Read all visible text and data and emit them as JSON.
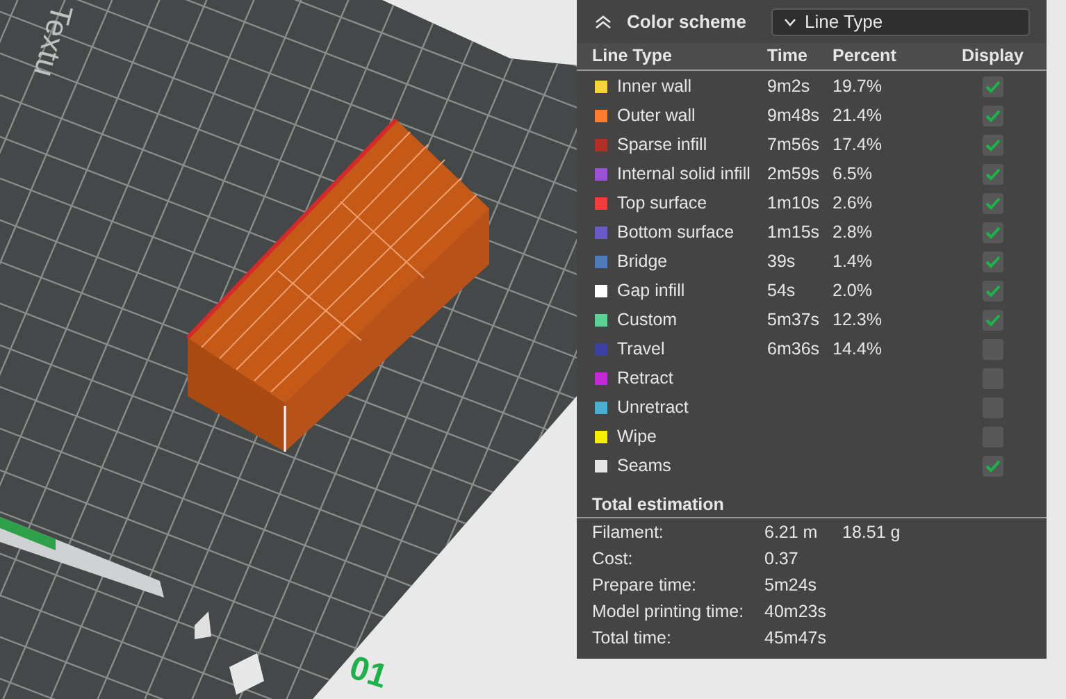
{
  "viewport": {
    "plate_label": "Textu",
    "plate_number": "01"
  },
  "header": {
    "title": "Color scheme",
    "dropdown": {
      "value": "Line Type"
    }
  },
  "table": {
    "columns": [
      "Line Type",
      "Time",
      "Percent",
      "Display"
    ],
    "rows": [
      {
        "name": "Inner wall",
        "color": "#f5d33a",
        "time": "9m2s",
        "percent": "19.7%",
        "display": true
      },
      {
        "name": "Outer wall",
        "color": "#ff7b2e",
        "time": "9m48s",
        "percent": "21.4%",
        "display": true
      },
      {
        "name": "Sparse infill",
        "color": "#b03029",
        "time": "7m56s",
        "percent": "17.4%",
        "display": true
      },
      {
        "name": "Internal solid infill",
        "color": "#9b51d6",
        "time": "2m59s",
        "percent": "6.5%",
        "display": true
      },
      {
        "name": "Top surface",
        "color": "#f03c3c",
        "time": "1m10s",
        "percent": "2.6%",
        "display": true
      },
      {
        "name": "Bottom surface",
        "color": "#6a5bc8",
        "time": "1m15s",
        "percent": "2.8%",
        "display": true
      },
      {
        "name": "Bridge",
        "color": "#4f7cb8",
        "time": "39s",
        "percent": "1.4%",
        "display": true
      },
      {
        "name": "Gap infill",
        "color": "#ffffff",
        "time": "54s",
        "percent": "2.0%",
        "display": true
      },
      {
        "name": "Custom",
        "color": "#5ed196",
        "time": "5m37s",
        "percent": "12.3%",
        "display": true
      },
      {
        "name": "Travel",
        "color": "#3a3fa0",
        "time": "6m36s",
        "percent": "14.4%",
        "display": false
      },
      {
        "name": "Retract",
        "color": "#c42bd6",
        "display": false
      },
      {
        "name": "Unretract",
        "color": "#4aaed0",
        "display": false
      },
      {
        "name": "Wipe",
        "color": "#f5f000",
        "display": false
      },
      {
        "name": "Seams",
        "color": "#e6e6e6",
        "display": true
      }
    ]
  },
  "total_estimation": {
    "title": "Total estimation",
    "rows": [
      {
        "label": "Filament:",
        "values": [
          "6.21 m",
          "18.51 g"
        ]
      },
      {
        "label": "Cost:",
        "values": [
          "0.37"
        ]
      },
      {
        "label": "Prepare time:",
        "values": [
          "5m24s"
        ]
      },
      {
        "label": "Model printing time:",
        "values": [
          "40m23s"
        ]
      },
      {
        "label": "Total time:",
        "values": [
          "45m47s"
        ]
      }
    ]
  }
}
